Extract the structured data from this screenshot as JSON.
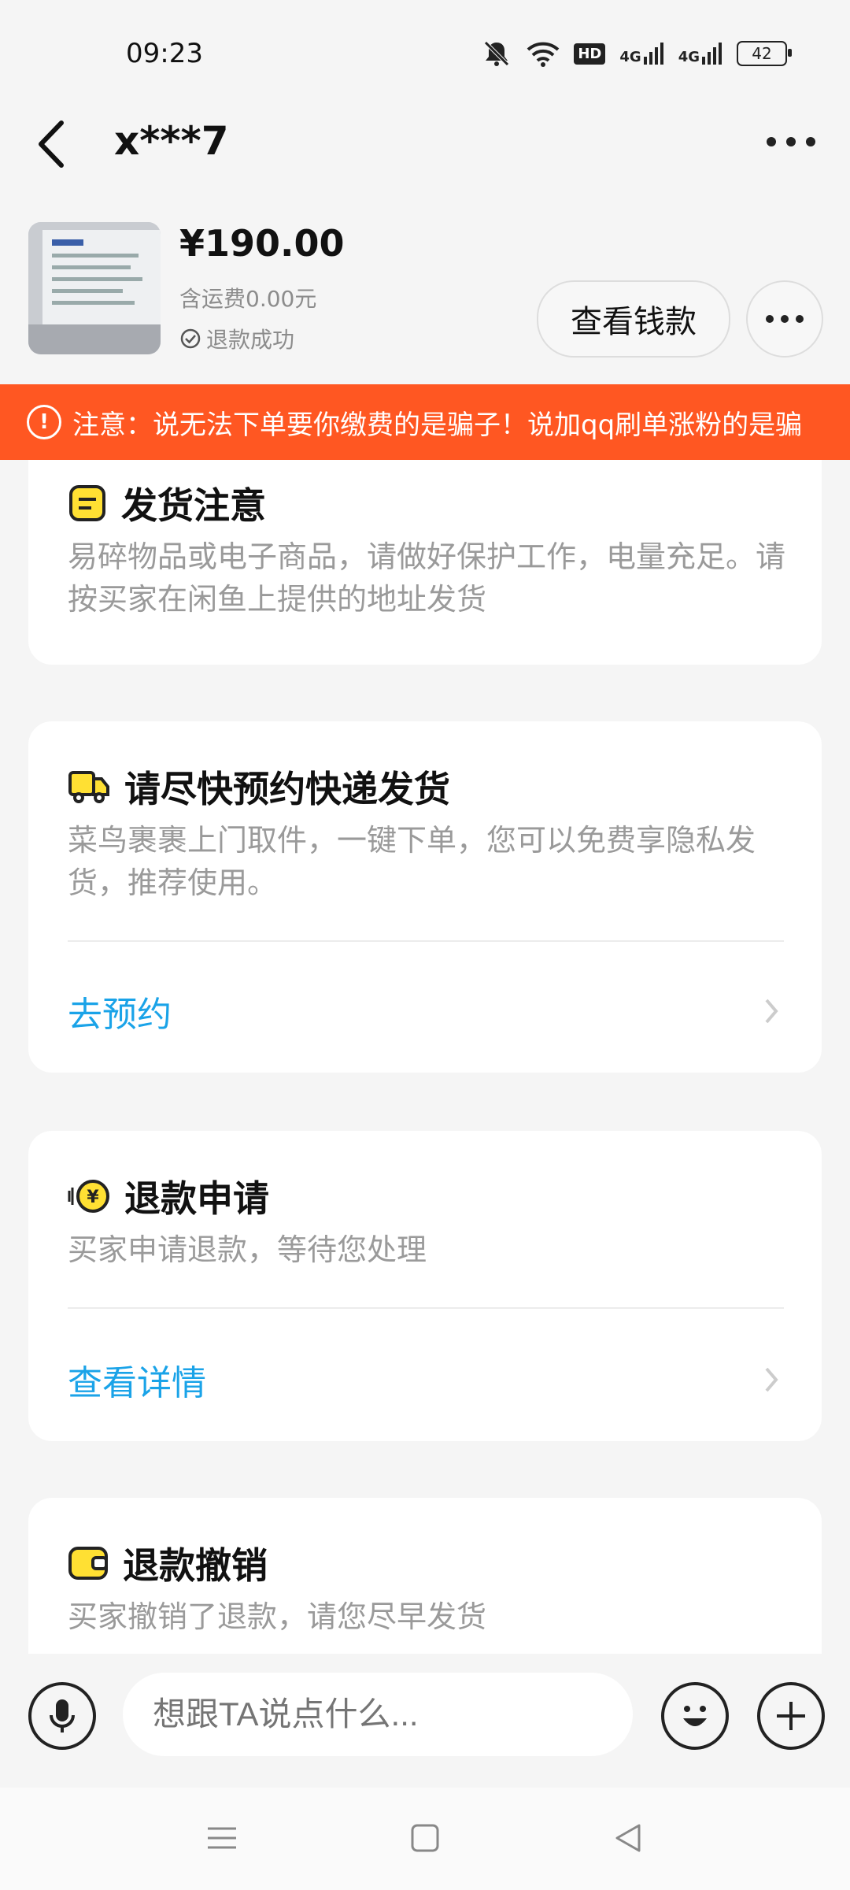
{
  "status_bar": {
    "time": "09:23",
    "battery": "42",
    "hd": "HD",
    "net1": "4G",
    "net2": "4G"
  },
  "header": {
    "title": "x***7"
  },
  "product": {
    "price": "¥190.00",
    "shipping": "含运费0.00元",
    "status": "退款成功",
    "view_money_button": "查看钱款"
  },
  "banner": {
    "text": "注意：说无法下单要你缴费的是骗子！说加qq刷单涨粉的是骗"
  },
  "cards": [
    {
      "title": "发货注意",
      "desc": "易碎物品或电子商品，请做好保护工作，电量充足。请按买家在闲鱼上提供的地址发货"
    },
    {
      "title": "请尽快预约快递发货",
      "desc": "菜鸟裹裹上门取件，一键下单，您可以免费享隐私发货，推荐使用。",
      "action": "去预约"
    },
    {
      "title": "退款申请",
      "desc": "买家申请退款，等待您处理",
      "action": "查看详情"
    },
    {
      "title": "退款撤销",
      "desc": "买家撤销了退款，请您尽早发货"
    }
  ],
  "input": {
    "placeholder": "想跟TA说点什么..."
  },
  "colors": {
    "accent_orange": "#ff5722",
    "link_blue": "#1aa3e8",
    "icon_yellow": "#ffe033"
  }
}
